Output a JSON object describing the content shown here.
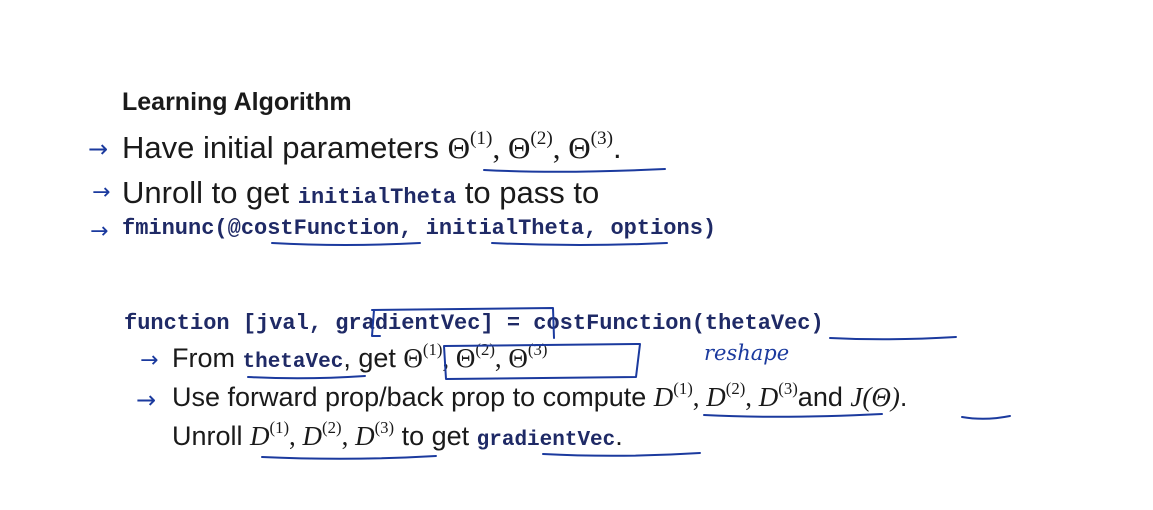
{
  "slide": {
    "title": "Learning Algorithm",
    "bullet1": {
      "text": "Have initial parameters ",
      "theta": "Θ",
      "sup1": "(1)",
      "sup2": "(2)",
      "sup3": "(3)",
      "sep": ", ",
      "end": "."
    },
    "bullet2": {
      "text1": "Unroll to get ",
      "code": "initialTheta",
      "text2": " to pass to"
    },
    "bullet3": {
      "call": "fminunc(@costFunction, initialTheta, options)"
    },
    "function_def": {
      "code": "function [jval, gradientVec] = costFunction(thetaVec)"
    },
    "step1": {
      "text1": "From ",
      "code": "thetaVec",
      "text2": ", get ",
      "theta": "Θ",
      "sup1": "(1)",
      "sup2": "(2)",
      "sup3": "(3)",
      "sep": ", ",
      "note": "reshape"
    },
    "step2": {
      "text1": "Use forward prop/back prop to compute ",
      "d": "D",
      "sup1": "(1)",
      "sup2": "(2)",
      "sup3": "(3)",
      "sep": ", ",
      "and": "and ",
      "j": "J(Θ)",
      "end": "."
    },
    "step3": {
      "text1": "Unroll ",
      "d": "D",
      "sup1": "(1)",
      "sup2": "(2)",
      "sup3": "(3)",
      "sep": ", ",
      "text2": " to get ",
      "code": "gradientVec",
      "end": "."
    },
    "ink_color": "#1b3a9e",
    "arrow_glyph": "→"
  }
}
